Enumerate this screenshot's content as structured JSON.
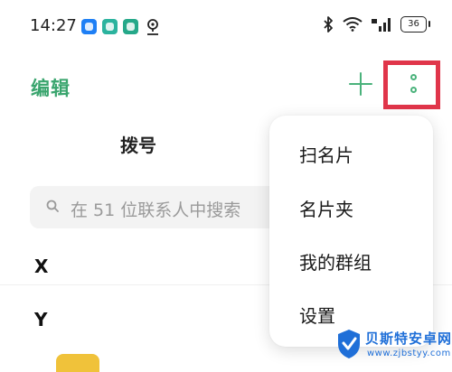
{
  "status_bar": {
    "time": "14:27",
    "battery": "36",
    "icons": [
      "bluetooth-app-icon",
      "chat-app-icon",
      "message-app-icon",
      "location-icon",
      "bluetooth-icon",
      "wifi-icon",
      "signal-icon",
      "battery-icon"
    ]
  },
  "header": {
    "edit_label": "编辑",
    "add_icon": "plus-icon",
    "more_icon": "more-vertical-icon",
    "accent_color": "#4ab27b",
    "highlight_color": "#e0354a"
  },
  "tabs": {
    "dial_label": "拨号"
  },
  "search": {
    "placeholder": "在 51 位联系人中搜索"
  },
  "contacts": {
    "sections": [
      "X",
      "Y"
    ]
  },
  "popup_menu": {
    "items": [
      {
        "label": "扫名片"
      },
      {
        "label": "名片夹"
      },
      {
        "label": "我的群组"
      },
      {
        "label": "设置"
      }
    ]
  },
  "watermark": {
    "title": "贝斯特安卓网",
    "url": "www.zjbstyy.com"
  }
}
